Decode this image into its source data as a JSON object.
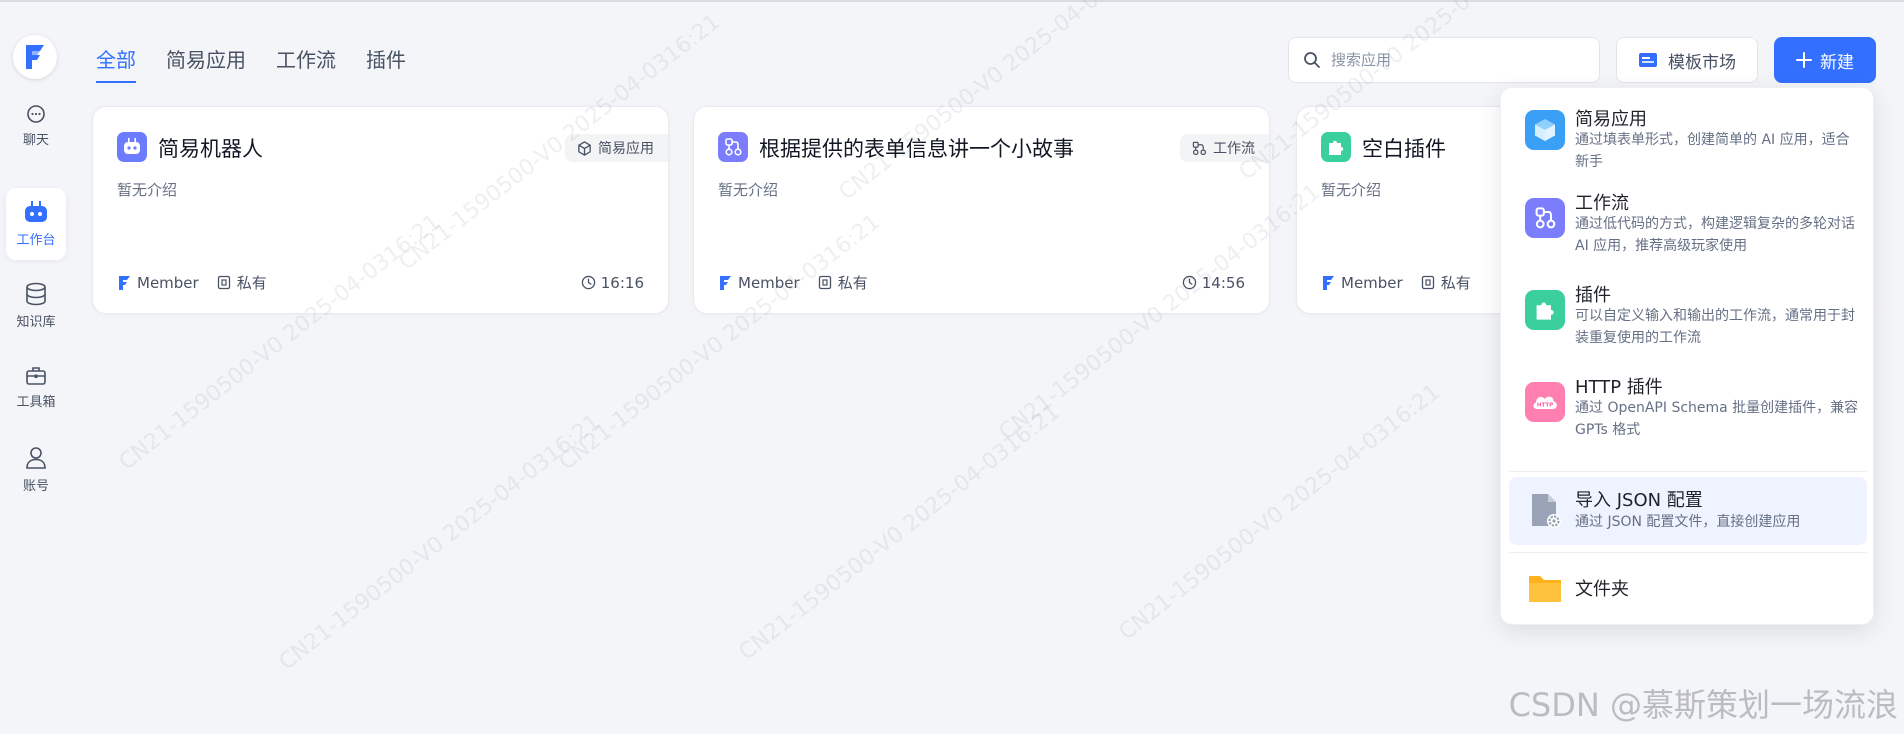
{
  "sidebar": {
    "items": [
      {
        "label": "聊天",
        "icon": "chat-bubble-icon"
      },
      {
        "label": "工作台",
        "icon": "robot-icon"
      },
      {
        "label": "知识库",
        "icon": "database-icon"
      },
      {
        "label": "工具箱",
        "icon": "toolbox-icon"
      },
      {
        "label": "账号",
        "icon": "user-icon"
      }
    ],
    "active": "工作台"
  },
  "tabs": [
    "全部",
    "简易应用",
    "工作流",
    "插件"
  ],
  "active_tab": "全部",
  "search": {
    "placeholder": "搜索应用"
  },
  "toolbar": {
    "market_label": "模板市场",
    "new_label": "新建"
  },
  "cards": [
    {
      "title": "简易机器人",
      "badge": "简易应用",
      "desc": "暂无介绍",
      "owner": "Member",
      "visibility": "私有",
      "time": "16:16",
      "icon": "robot-icon",
      "icon_color": "#6b7cff"
    },
    {
      "title": "根据提供的表单信息讲一个小故事",
      "badge": "工作流",
      "desc": "暂无介绍",
      "owner": "Member",
      "visibility": "私有",
      "time": "14:56",
      "icon": "workflow-icon",
      "icon_color": "#7b7dfd"
    },
    {
      "title": "空白插件",
      "badge": "",
      "desc": "暂无介绍",
      "owner": "Member",
      "visibility": "私有",
      "time": "",
      "icon": "puzzle-icon",
      "icon_color": "#3ccf9e"
    }
  ],
  "menu": {
    "items": [
      {
        "title": "简易应用",
        "desc": "通过填表单形式，创建简单的 AI 应用，适合新手",
        "icon": "cube-icon"
      },
      {
        "title": "工作流",
        "desc": "通过低代码的方式，构建逻辑复杂的多轮对话 AI 应用，推荐高级玩家使用",
        "icon": "workflow-icon"
      },
      {
        "title": "插件",
        "desc": "可以自定义输入和输出的工作流，通常用于封装重复使用的工作流",
        "icon": "puzzle-icon"
      },
      {
        "title": "HTTP 插件",
        "desc": "通过 OpenAPI Schema 批量创建插件，兼容 GPTs 格式",
        "icon": "http-cloud-icon"
      },
      {
        "title": "导入 JSON 配置",
        "desc": "通过 JSON 配置文件，直接创建应用",
        "icon": "json-file-icon"
      },
      {
        "title": "文件夹",
        "desc": "",
        "icon": "folder-icon"
      }
    ]
  },
  "watermark_text": "CN21-1590500-V0 2025-04-0316:21",
  "csdn_watermark": "CSDN @慕斯策划一场流浪",
  "colors": {
    "accent": "#3370ff",
    "background": "#f4f5f8"
  }
}
